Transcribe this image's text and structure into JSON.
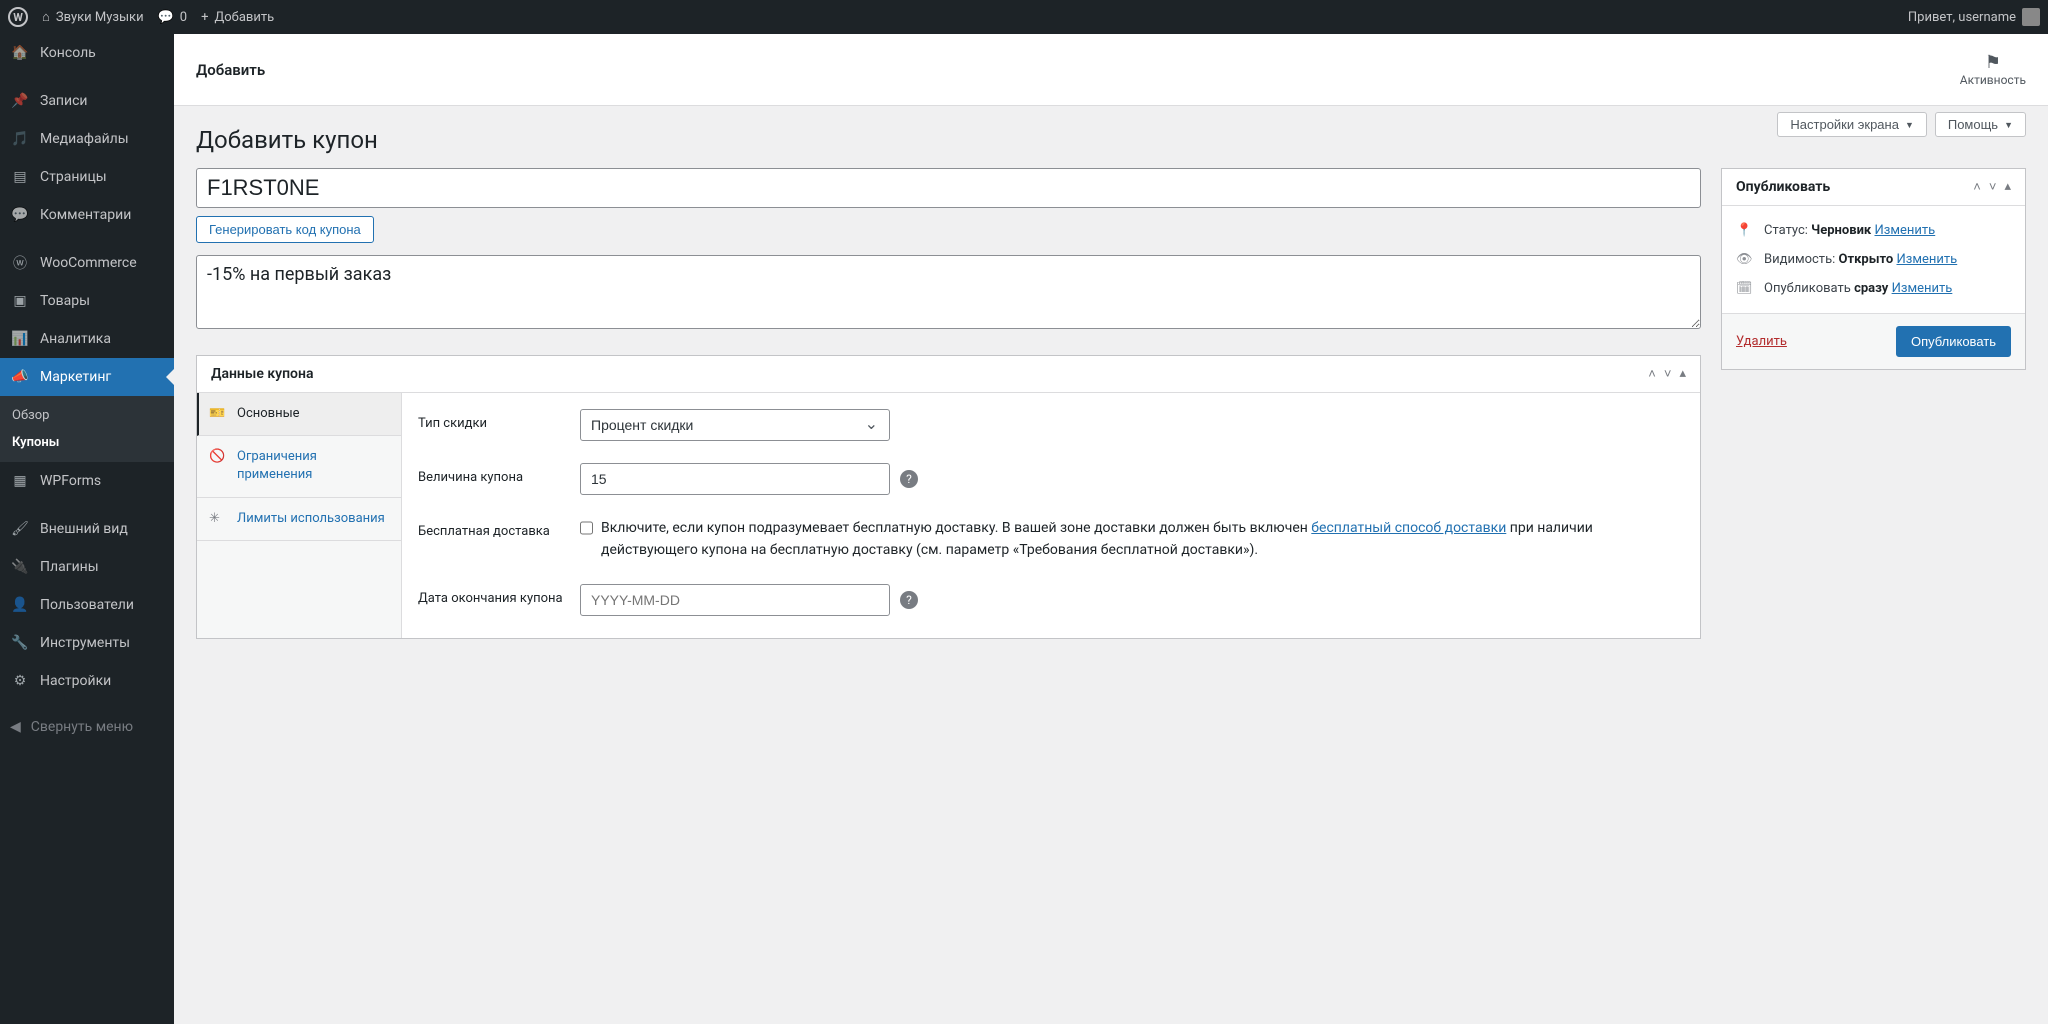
{
  "toolbar": {
    "site_name": "Звуки Музыки",
    "comments": "0",
    "add_new": "Добавить",
    "greeting": "Привет, username"
  },
  "adminmenu": {
    "dashboard": "Консоль",
    "posts": "Записи",
    "media": "Медиафайлы",
    "pages": "Страницы",
    "comments": "Комментарии",
    "woocommerce": "WooCommerce",
    "products": "Товары",
    "analytics": "Аналитика",
    "marketing": "Маркетинг",
    "marketing_sub": {
      "overview": "Обзор",
      "coupons": "Купоны"
    },
    "wpforms": "WPForms",
    "appearance": "Внешний вид",
    "plugins": "Плагины",
    "users": "Пользователи",
    "tools": "Инструменты",
    "settings": "Настройки",
    "collapse": "Свернуть меню"
  },
  "header": {
    "page_action": "Добавить",
    "activity": "Активность",
    "screen_options": "Настройки экрана",
    "help": "Помощь"
  },
  "page": {
    "title": "Добавить купон",
    "code_value": "F1RST0NE",
    "generate_btn": "Генерировать код купона",
    "desc_value": "-15% на первый заказ"
  },
  "coupon_box": {
    "title": "Данные купона",
    "tabs": {
      "general": "Основные",
      "restriction": "Ограничения применения",
      "limits": "Лимиты использования"
    },
    "labels": {
      "type": "Тип скидки",
      "amount": "Величина купона",
      "freeship": "Бесплатная доставка",
      "expiry": "Дата окончания купона"
    },
    "type_value": "Процент скидки",
    "amount_value": "15",
    "expiry_placeholder": "YYYY-MM-DD",
    "freeship_text_1": "Включите, если купон подразумевает бесплатную доставку. В вашей зоне доставки должен быть включен ",
    "freeship_link": "бесплатный способ доставки",
    "freeship_text_2": " при наличии действующего купона на бесплатную доставку (см. параметр «Требования бесплатной доставки»)."
  },
  "publish": {
    "title": "Опубликовать",
    "status_label": "Статус:",
    "status_value": "Черновик",
    "visibility_label": "Видимость:",
    "visibility_value": "Открыто",
    "schedule_label": "Опубликовать",
    "schedule_value": "сразу",
    "edit": "Изменить",
    "delete": "Удалить",
    "publish_btn": "Опубликовать"
  }
}
